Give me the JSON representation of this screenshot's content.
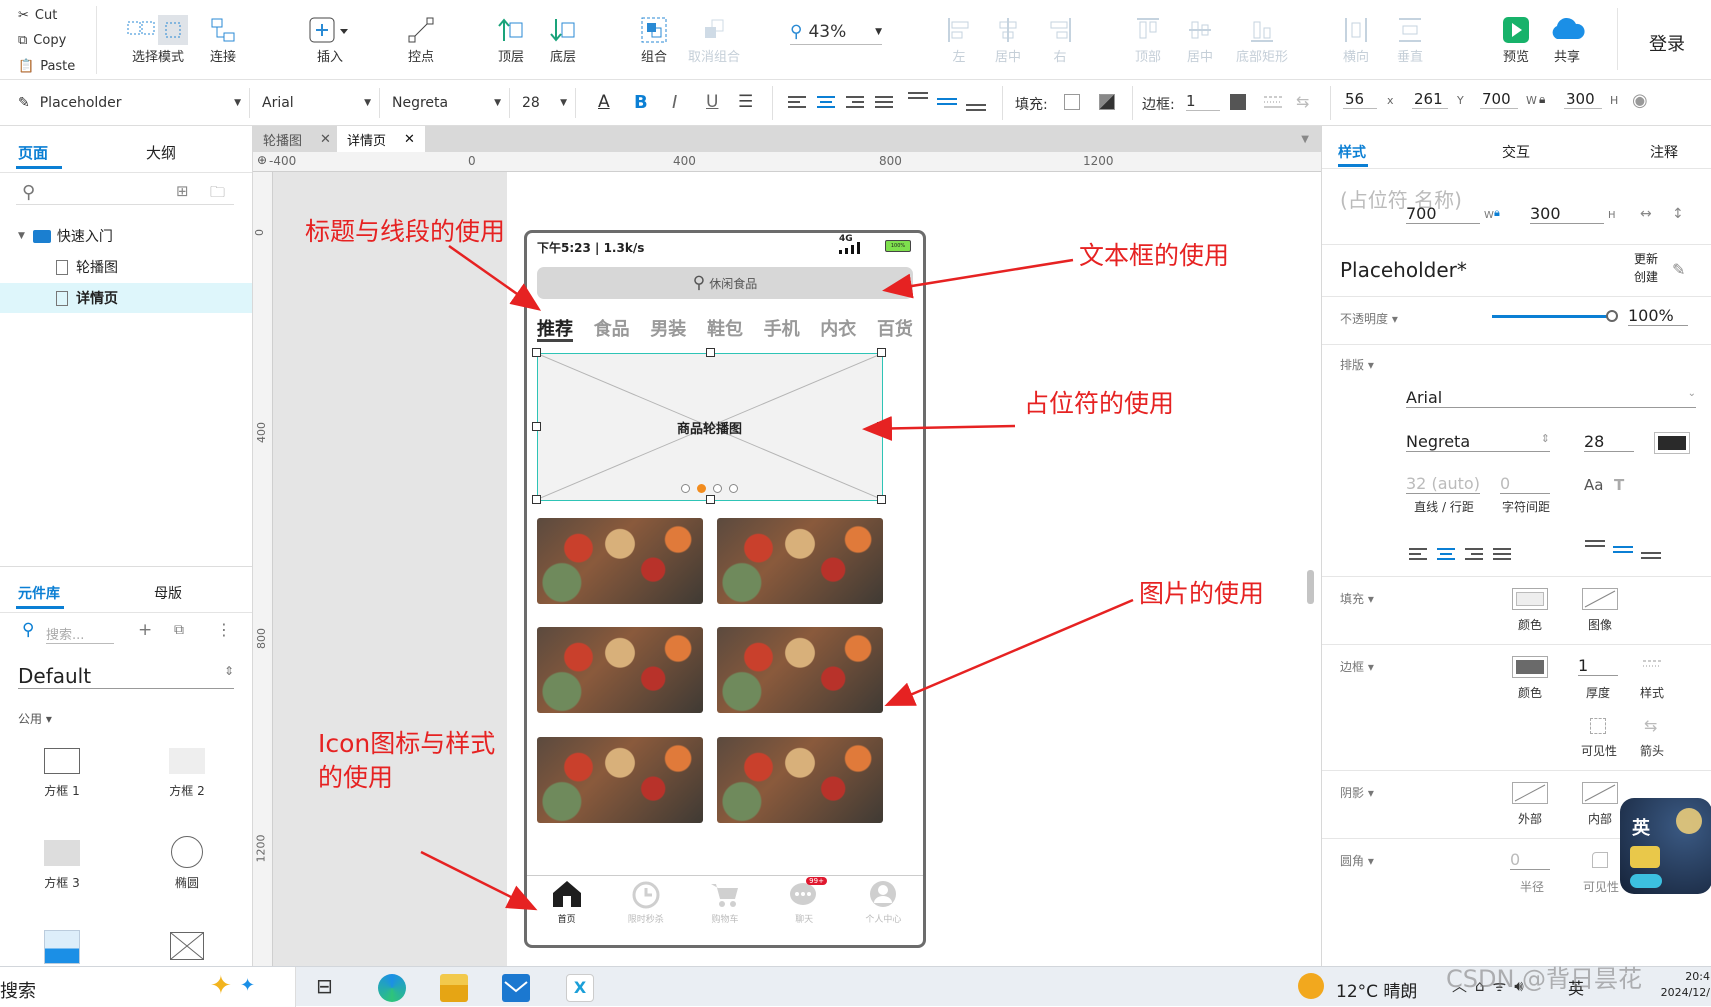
{
  "clipboard": {
    "cut": "Cut",
    "copy": "Copy",
    "paste": "Paste"
  },
  "toolbar": {
    "select_mode": "选择模式",
    "connect": "连接",
    "insert": "插入",
    "points": "控点",
    "top_layer": "顶层",
    "bottom_layer": "底层",
    "group": "组合",
    "ungroup": "取消组合",
    "zoom": "43%",
    "align_left": "左",
    "align_center": "居中",
    "align_right": "右",
    "align_top": "顶部",
    "align_middle": "居中",
    "align_bottom": "底部矩形",
    "distribute_h": "横向",
    "distribute_v": "垂直",
    "preview": "预览",
    "share": "共享",
    "login": "登录"
  },
  "format": {
    "style_name": "Placeholder",
    "font": "Arial",
    "weight": "Negreta",
    "size": "28",
    "fill_label": "填充:",
    "border_label": "边框:",
    "border_value": "1",
    "x": "56",
    "x_label": "x",
    "y": "261",
    "y_label": "Y",
    "w": "700",
    "w_label": "W",
    "h": "300",
    "h_label": "H"
  },
  "left_panel": {
    "tabs": [
      "页面",
      "大纲"
    ],
    "tree": {
      "folder": "快速入门",
      "pages": [
        "轮播图",
        "详情页"
      ]
    },
    "lib_tabs": [
      "元件库",
      "母版"
    ],
    "search_placeholder": "搜索...",
    "library": "Default",
    "category": "公用",
    "components": [
      "方框 1",
      "方框 2",
      "方框 3",
      "椭圆"
    ]
  },
  "doc_tabs": [
    "轮播图",
    "详情页"
  ],
  "ruler": {
    "h": [
      "-400",
      "0",
      "400",
      "800",
      "1200"
    ],
    "v": [
      "0",
      "400",
      "800",
      "1200"
    ]
  },
  "phone": {
    "status": "下午5:23 | 1.3k/s",
    "network": "4G",
    "battery": "100%",
    "search_text": "休闲食品",
    "categories": [
      "推荐",
      "食品",
      "男装",
      "鞋包",
      "手机",
      "内衣",
      "百货"
    ],
    "carousel_label": "商品轮播图",
    "nav": [
      "首页",
      "限时秒杀",
      "购物车",
      "聊天",
      "个人中心"
    ],
    "badge": "99+"
  },
  "annotations": {
    "title": "标题与线段的使用",
    "textbox": "文本框的使用",
    "placeholder": "占位符的使用",
    "image": "图片的使用",
    "icon_line1": "Icon图标与样式",
    "icon_line2": "的使用"
  },
  "right_panel": {
    "tabs": [
      "样式",
      "交互",
      "注释"
    ],
    "name_placeholder": "(占位符 名称)",
    "w": "700",
    "w_label": "W",
    "h": "300",
    "h_label": "H",
    "style_name": "Placeholder*",
    "update": "更新",
    "create": "创建",
    "opacity_label": "不透明度",
    "opacity": "100%",
    "typography_label": "排版",
    "font": "Arial",
    "weight": "Negreta",
    "size": "28",
    "line_height": "32 (auto)",
    "line_height_label": "直线 / 行距",
    "char_spacing": "0",
    "char_spacing_label": "字符间距",
    "fill_label": "填充",
    "fill_color": "颜色",
    "fill_image": "图像",
    "border_label": "边框",
    "border_color": "颜色",
    "border_thickness": "1",
    "thickness_label": "厚度",
    "style_label": "样式",
    "visibility": "可见性",
    "arrow": "箭头",
    "shadow_label": "阴影",
    "shadow_outer": "外部",
    "shadow_inner": "内部",
    "corner_label": "圆角",
    "corner_value": "0",
    "radius_label": "半径",
    "visible_label": "可见性"
  },
  "taskbar": {
    "search": "搜索",
    "weather": "12°C  晴朗",
    "ime": "英",
    "watermark": "CSDN @背日昙花",
    "time": "20:4",
    "date": "2024/12/"
  },
  "colors": {
    "accent": "#0b7fd4",
    "annotation": "#e62222",
    "selection": "#2ec4b6",
    "orange": "#f28c1e"
  }
}
